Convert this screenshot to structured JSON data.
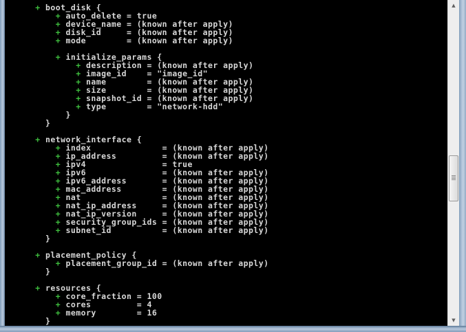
{
  "console": {
    "lines": [
      {
        "indent": "      ",
        "marker": "+",
        "text": " boot_disk {"
      },
      {
        "indent": "          ",
        "marker": "+",
        "text": " auto_delete = true"
      },
      {
        "indent": "          ",
        "marker": "+",
        "text": " device_name = (known after apply)"
      },
      {
        "indent": "          ",
        "marker": "+",
        "text": " disk_id     = (known after apply)"
      },
      {
        "indent": "          ",
        "marker": "+",
        "text": " mode        = (known after apply)"
      },
      {
        "indent": "",
        "marker": "",
        "text": ""
      },
      {
        "indent": "          ",
        "marker": "+",
        "text": " initialize_params {"
      },
      {
        "indent": "              ",
        "marker": "+",
        "text": " description = (known after apply)"
      },
      {
        "indent": "              ",
        "marker": "+",
        "text": " image_id    = \"image_id\""
      },
      {
        "indent": "              ",
        "marker": "+",
        "text": " name        = (known after apply)"
      },
      {
        "indent": "              ",
        "marker": "+",
        "text": " size        = (known after apply)"
      },
      {
        "indent": "              ",
        "marker": "+",
        "text": " snapshot_id = (known after apply)"
      },
      {
        "indent": "              ",
        "marker": "+",
        "text": " type        = \"network-hdd\""
      },
      {
        "indent": "            ",
        "marker": "",
        "text": "}"
      },
      {
        "indent": "        ",
        "marker": "",
        "text": "}"
      },
      {
        "indent": "",
        "marker": "",
        "text": ""
      },
      {
        "indent": "      ",
        "marker": "+",
        "text": " network_interface {"
      },
      {
        "indent": "          ",
        "marker": "+",
        "text": " index              = (known after apply)"
      },
      {
        "indent": "          ",
        "marker": "+",
        "text": " ip_address         = (known after apply)"
      },
      {
        "indent": "          ",
        "marker": "+",
        "text": " ipv4               = true"
      },
      {
        "indent": "          ",
        "marker": "+",
        "text": " ipv6               = (known after apply)"
      },
      {
        "indent": "          ",
        "marker": "+",
        "text": " ipv6_address       = (known after apply)"
      },
      {
        "indent": "          ",
        "marker": "+",
        "text": " mac_address        = (known after apply)"
      },
      {
        "indent": "          ",
        "marker": "+",
        "text": " nat                = (known after apply)"
      },
      {
        "indent": "          ",
        "marker": "+",
        "text": " nat_ip_address     = (known after apply)"
      },
      {
        "indent": "          ",
        "marker": "+",
        "text": " nat_ip_version     = (known after apply)"
      },
      {
        "indent": "          ",
        "marker": "+",
        "text": " security_group_ids = (known after apply)"
      },
      {
        "indent": "          ",
        "marker": "+",
        "text": " subnet_id          = (known after apply)"
      },
      {
        "indent": "        ",
        "marker": "",
        "text": "}"
      },
      {
        "indent": "",
        "marker": "",
        "text": ""
      },
      {
        "indent": "      ",
        "marker": "+",
        "text": " placement_policy {"
      },
      {
        "indent": "          ",
        "marker": "+",
        "text": " placement_group_id = (known after apply)"
      },
      {
        "indent": "        ",
        "marker": "",
        "text": "}"
      },
      {
        "indent": "",
        "marker": "",
        "text": ""
      },
      {
        "indent": "      ",
        "marker": "+",
        "text": " resources {"
      },
      {
        "indent": "          ",
        "marker": "+",
        "text": " core_fraction = 100"
      },
      {
        "indent": "          ",
        "marker": "+",
        "text": " cores         = 4"
      },
      {
        "indent": "          ",
        "marker": "+",
        "text": " memory        = 16"
      },
      {
        "indent": "        ",
        "marker": "",
        "text": "}"
      }
    ]
  },
  "scrollbar": {
    "up_arrow_icon": "triangle-up",
    "down_arrow_icon": "triangle-down",
    "up_glyph": "▲",
    "down_glyph": "▼",
    "position_fraction": 0.56
  },
  "colors": {
    "background": "#000000",
    "text": "#d8d8d8",
    "plus_marker": "#3fbf3f"
  }
}
